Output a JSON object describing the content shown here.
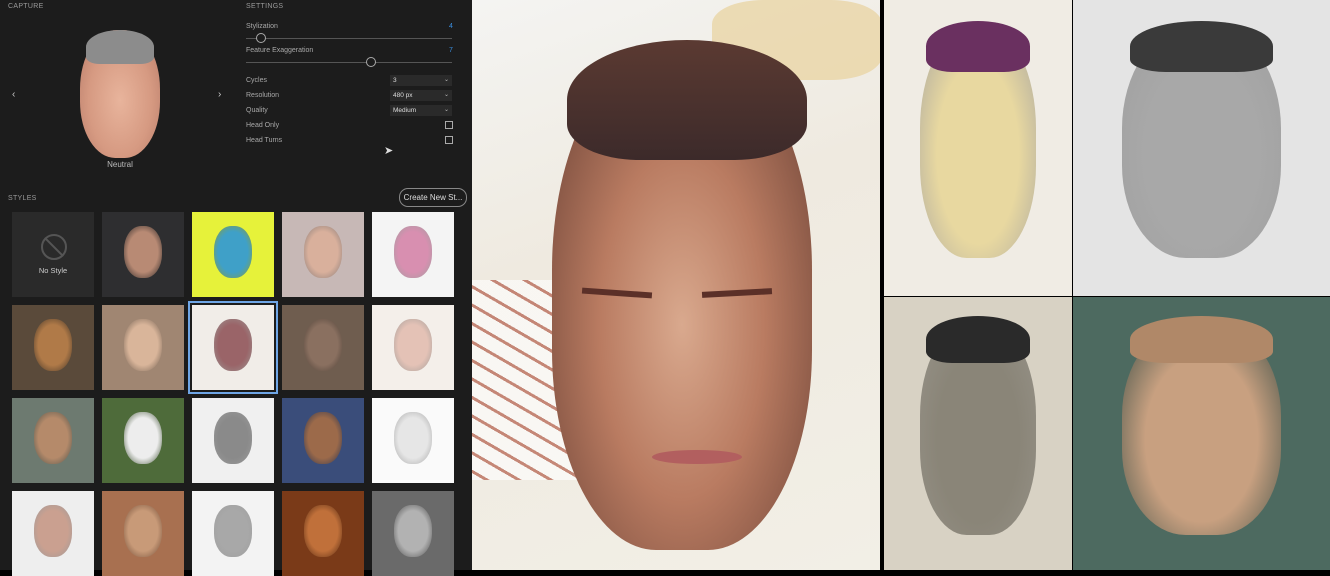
{
  "capture": {
    "label": "CAPTURE",
    "expression": "Neutral",
    "prev_icon": "chevron-left-icon",
    "next_icon": "chevron-right-icon"
  },
  "settings": {
    "label": "SETTINGS",
    "stylization": {
      "label": "Stylization",
      "value": "4"
    },
    "feature_exaggeration": {
      "label": "Feature Exaggeration",
      "value": "7"
    },
    "cycles": {
      "label": "Cycles",
      "value": "3"
    },
    "resolution": {
      "label": "Resolution",
      "value": "480 px"
    },
    "quality": {
      "label": "Quality",
      "value": "Medium"
    },
    "head_only": {
      "label": "Head Only",
      "checked": false
    },
    "head_turns": {
      "label": "Head Turns",
      "checked": false
    }
  },
  "styles": {
    "label": "STYLES",
    "create_button": "Create New St...",
    "no_style_label": "No Style",
    "tiles": [
      {
        "name": "no-style",
        "type": "none"
      },
      {
        "name": "photo-man",
        "bg": "#2e2e30",
        "face": "#b88a74"
      },
      {
        "name": "pop-art-green",
        "bg": "#e6f23a",
        "face": "#3fa0c8"
      },
      {
        "name": "curly-girl-painting",
        "bg": "#c7b8b6",
        "face": "#d9b09c"
      },
      {
        "name": "rainbow-hair-sketch",
        "bg": "#f4f4f4",
        "face": "#d88fb0"
      },
      {
        "name": "wood-carving",
        "bg": "#5a4a3a",
        "face": "#b07a48"
      },
      {
        "name": "pencil-woman",
        "bg": "#a08672",
        "face": "#d9b59a"
      },
      {
        "name": "ink-curly-woman",
        "bg": "#f1ede8",
        "face": "#9a6468",
        "selected": true
      },
      {
        "name": "clay-sculpture",
        "bg": "#6f5d4f",
        "face": "#8a7060"
      },
      {
        "name": "red-pencil-woman",
        "bg": "#f4efea",
        "face": "#e4c2b6"
      },
      {
        "name": "old-man-painting",
        "bg": "#6d7a70",
        "face": "#b58a6a"
      },
      {
        "name": "white-mannequin",
        "bg": "#4e6b3a",
        "face": "#ededed"
      },
      {
        "name": "charcoal-man",
        "bg": "#f0f0f0",
        "face": "#8a8a8a"
      },
      {
        "name": "portrait-woman-blue",
        "bg": "#3a4d7a",
        "face": "#9c6a4a"
      },
      {
        "name": "line-drawing-man",
        "bg": "#fafafa",
        "face": "#e6e6e6"
      },
      {
        "name": "bob-hair-woman",
        "bg": "#eeeeee",
        "face": "#caa090"
      },
      {
        "name": "marble-bust",
        "bg": "#a87050",
        "face": "#c89a78"
      },
      {
        "name": "pencil-man-beard",
        "bg": "#f3f3f3",
        "face": "#a8a8a8"
      },
      {
        "name": "dog-golden",
        "bg": "#7a3a18",
        "face": "#c0703a"
      },
      {
        "name": "anatomy-man",
        "bg": "#6a6a6a",
        "face": "#b2b2b2"
      }
    ]
  },
  "results": {
    "main": {
      "name": "main-stylized-portrait"
    },
    "thumbs": [
      {
        "name": "watercolor-purple-portrait",
        "bg": "#f0ece4",
        "face": "#e8d8a0",
        "hair": "#6a3060"
      },
      {
        "name": "anatomy-grey-portrait",
        "bg": "#e4e4e4",
        "face": "#a8a8a8",
        "hair": "#3a3a3a"
      },
      {
        "name": "charcoal-sketch-portrait",
        "bg": "#d8d2c4",
        "face": "#8a8578",
        "hair": "#2a2a2a"
      },
      {
        "name": "wood-textured-portrait",
        "bg": "#4d6a60",
        "face": "#c8a080",
        "hair": "#b08868"
      }
    ]
  }
}
